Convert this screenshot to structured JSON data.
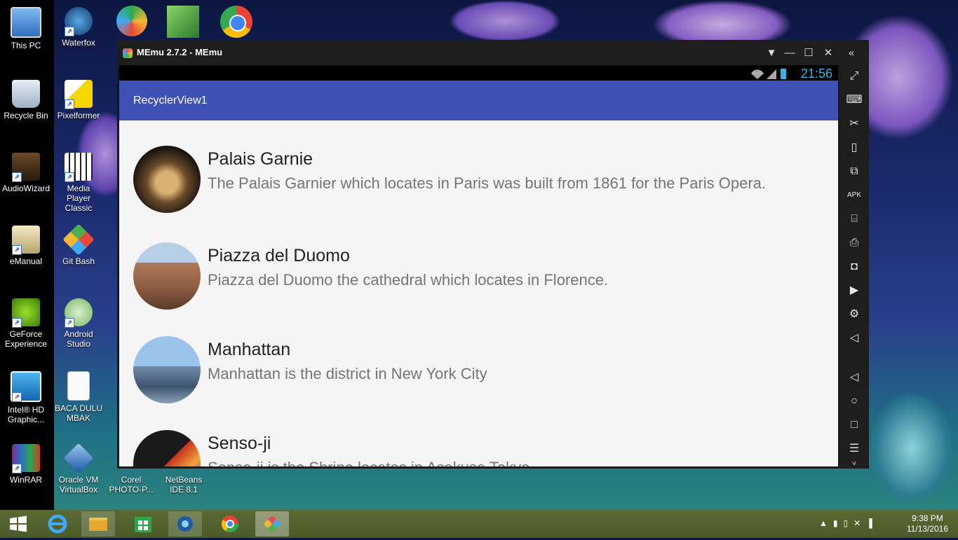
{
  "desktop": {
    "icons": [
      {
        "label": "This PC"
      },
      {
        "label": "Waterfox"
      },
      {
        "label": "Recycle Bin"
      },
      {
        "label": "Pixelformer"
      },
      {
        "label": "AudioWizard"
      },
      {
        "label": "Media Player Classic"
      },
      {
        "label": "eManual"
      },
      {
        "label": "Git Bash"
      },
      {
        "label": "GeForce Experience"
      },
      {
        "label": "Android Studio"
      },
      {
        "label": "Intel® HD Graphic..."
      },
      {
        "label": "BACA DULU MBAK"
      },
      {
        "label": "WinRAR"
      },
      {
        "label": "Oracle VM VirtualBox"
      },
      {
        "label": "Corel PHOTO-P..."
      },
      {
        "label": "NetBeans IDE 8.1"
      }
    ]
  },
  "window": {
    "title": "MEmu 2.7.2 - MEmu"
  },
  "android": {
    "time": "21:56",
    "app_title": "RecyclerView1",
    "items": [
      {
        "title": "Palais Garnie",
        "desc": "The Palais Garnier which locates in Paris was built from 1861 for the Paris Opera."
      },
      {
        "title": "Piazza del Duomo",
        "desc": "Piazza del Duomo the cathedral which locates in Florence."
      },
      {
        "title": "Manhattan",
        "desc": "Manhattan is the district in New York City"
      },
      {
        "title": "Senso-ji",
        "desc": "Senso-ji is the Shrine locates in Asakusa Tokyo"
      }
    ]
  },
  "taskbar": {
    "time": "9:38 PM",
    "date": "11/13/2016"
  },
  "colors": {
    "appbar": "#3f51b5",
    "status_time": "#33b5e5"
  }
}
